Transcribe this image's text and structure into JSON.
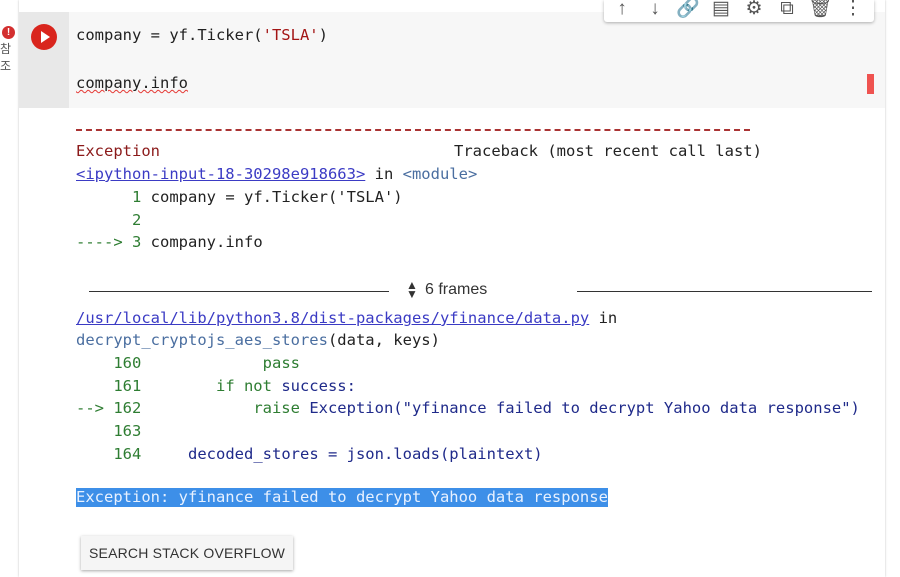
{
  "side": {
    "error_icon": "!",
    "side_text": "참조"
  },
  "toolbar": {
    "icons": [
      "arrow-up-icon",
      "arrow-down-icon",
      "link-icon",
      "comment-icon",
      "gear-icon",
      "mirror-cell-icon",
      "trash-icon",
      "more-vert-icon"
    ],
    "glyphs": [
      "↑",
      "↓",
      "🔗",
      "▤",
      "⚙",
      "⧉",
      "🗑",
      "⋮"
    ]
  },
  "code": {
    "line1_prefix": "company = yf.Ticker(",
    "line1_string": "'TSLA'",
    "line1_suffix": ")",
    "line3": "company.info"
  },
  "output": {
    "separator": "---------------------------------------------------------------------------",
    "exception_name": "Exception",
    "traceback_header": "Traceback (most recent call last)",
    "input_link": "<ipython-input-18-30298e918663>",
    "in_word": " in ",
    "module": "<module>",
    "tb1": [
      {
        "arrow": "      ",
        "num": "1",
        "code": " company = yf.Ticker('TSLA')"
      },
      {
        "arrow": "      ",
        "num": "2",
        "code": ""
      },
      {
        "arrow": "----> ",
        "num": "3",
        "code": " company.info"
      }
    ],
    "frames_label": "6 frames",
    "file_link": "/usr/local/lib/python3.8/dist-packages/yfinance/data.py",
    "func_name": "decrypt_cryptojs_aes_stores",
    "func_args": "(data, keys)",
    "tb2": [
      {
        "arrow": "    ",
        "num": "160",
        "indent": "             ",
        "kw": "pass",
        "rest": ""
      },
      {
        "arrow": "    ",
        "num": "161",
        "indent": "        ",
        "kw": "if not",
        "rest": " success:"
      },
      {
        "arrow": "--> ",
        "num": "162",
        "indent": "            ",
        "kw": "raise",
        "rest": " Exception(\"yfinance failed to decrypt Yahoo data response\")"
      },
      {
        "arrow": "    ",
        "num": "163",
        "indent": "",
        "kw": "",
        "rest": ""
      },
      {
        "arrow": "    ",
        "num": "164",
        "indent": "     ",
        "kw": "",
        "rest": "decoded_stores = json.loads(plaintext)"
      }
    ],
    "exception_message": "Exception: yfinance failed to decrypt Yahoo data response",
    "search_button": "SEARCH STACK OVERFLOW"
  }
}
